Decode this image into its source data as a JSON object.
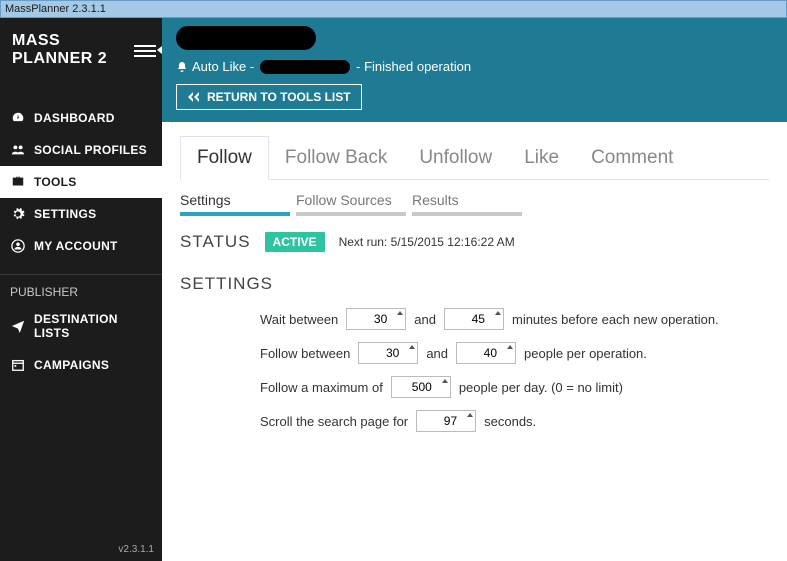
{
  "window": {
    "title": "MassPlanner 2.3.1.1"
  },
  "sidebar": {
    "logo_line1": "MASS",
    "logo_line2": "PLANNER 2",
    "items": [
      {
        "label": "DASHBOARD",
        "icon": "speedometer"
      },
      {
        "label": "SOCIAL PROFILES",
        "icon": "users"
      },
      {
        "label": "TOOLS",
        "icon": "briefcase",
        "active": true
      },
      {
        "label": "SETTINGS",
        "icon": "gear"
      },
      {
        "label": "MY ACCOUNT",
        "icon": "user-circle"
      }
    ],
    "publisher_label": "PUBLISHER",
    "publisher_items": [
      {
        "label": "DESTINATION LISTS",
        "icon": "send"
      },
      {
        "label": "CAMPAIGNS",
        "icon": "calendar"
      }
    ],
    "version": "v2.3.1.1"
  },
  "header": {
    "auto_like_prefix": "Auto Like -",
    "auto_like_suffix": "- Finished operation",
    "return_button": "RETURN TO TOOLS LIST"
  },
  "tabs": {
    "main": [
      "Follow",
      "Follow Back",
      "Unfollow",
      "Like",
      "Comment"
    ],
    "main_active": 0,
    "sub": [
      "Settings",
      "Follow Sources",
      "Results"
    ],
    "sub_active": 0
  },
  "status": {
    "label": "STATUS",
    "value": "ACTIVE",
    "next_run": "Next run: 5/15/2015 12:16:22 AM"
  },
  "settings": {
    "heading": "SETTINGS",
    "wait": {
      "label": "Wait between",
      "from": 30,
      "and": "and",
      "to": 45,
      "suffix": "minutes before each new operation."
    },
    "follow_between": {
      "label": "Follow between",
      "from": 30,
      "and": "and",
      "to": 40,
      "suffix": "people per operation."
    },
    "follow_max": {
      "label": "Follow a maximum of",
      "value": 500,
      "suffix": "people per day. (0 = no limit)"
    },
    "scroll": {
      "label": "Scroll the search page for",
      "value": 97,
      "suffix": "seconds."
    }
  }
}
